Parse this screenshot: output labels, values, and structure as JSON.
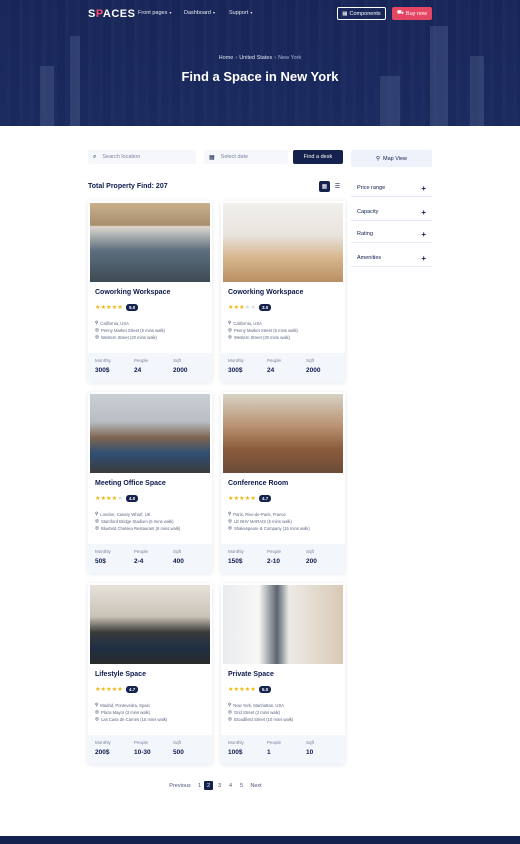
{
  "nav": {
    "logo_pre": "S",
    "logo_o": "P",
    "logo_post": "ACES",
    "items": [
      "Front pages",
      "Dashboard",
      "Support"
    ],
    "components_label": "Components",
    "buy_label": "Buy now"
  },
  "breadcrumb": [
    "Home",
    "United States",
    "New York"
  ],
  "hero_title": "Find a Space in New York",
  "search": {
    "location_placeholder": "Search location",
    "date_placeholder": "Select date",
    "find_label": "Find a desk",
    "map_label": "Map View"
  },
  "total_label": "Total Property Find: 207",
  "filters": [
    "Price range",
    "Capacity",
    "Rating",
    "Amenities"
  ],
  "stat_labels": [
    "Monthly",
    "People",
    "Sqft"
  ],
  "cards": [
    {
      "name": "Coworking Workspace",
      "rating": 5,
      "score": "5.0",
      "locs": [
        "California, USA",
        "Penny Market Street (5 mins walk)",
        "Western Street (20 mins walk)"
      ],
      "monthly": "300$",
      "people": "24",
      "sqft": "2000"
    },
    {
      "name": "Coworking Workspace",
      "rating": 3,
      "score": "3.0",
      "locs": [
        "California, USA",
        "Penny Market Street (5 mins walk)",
        "Western Street (20 mins walk)"
      ],
      "monthly": "300$",
      "people": "24",
      "sqft": "2000"
    },
    {
      "name": "Meeting Office Space",
      "rating": 4,
      "score": "4.0",
      "locs": [
        "London, Canary Wharf, UK",
        "Stamford Bridge Stadium (5 mins walk)",
        "Bluebird Chelsea Restaurant (5 mins walk)"
      ],
      "monthly": "50$",
      "people": "2-4",
      "sqft": "400"
    },
    {
      "name": "Conference Room",
      "rating": 5,
      "score": "4.7",
      "locs": [
        "Paris, Rive-de-Paris, France",
        "LE BHV MARAIS (5 mins walk)",
        "Shakespeare & Company (15 mins walk)"
      ],
      "monthly": "150$",
      "people": "2-10",
      "sqft": "200"
    },
    {
      "name": "Lifestyle Space",
      "rating": 5,
      "score": "4.7",
      "locs": [
        "Madrid, Pontevedra, Spain",
        "Plaza Mayor (3 mins walk)",
        "Las Casa de Carnes (15 mins walk)"
      ],
      "monthly": "200$",
      "people": "10-30",
      "sqft": "500"
    },
    {
      "name": "Private Space",
      "rating": 5,
      "score": "5.0",
      "locs": [
        "New York, Manhattan, USA",
        "Grid Street (2 mins walk)",
        "Broadfield Street (10 mins walk)"
      ],
      "monthly": "100$",
      "people": "1",
      "sqft": "10"
    }
  ],
  "pagination": {
    "previous": "Previous",
    "pages": [
      "1",
      "2",
      "3",
      "4",
      "5"
    ],
    "active": "2",
    "next": "Next"
  },
  "colors": {
    "navy": "#14224d",
    "accent": "#e54664",
    "star": "#f2b400"
  }
}
